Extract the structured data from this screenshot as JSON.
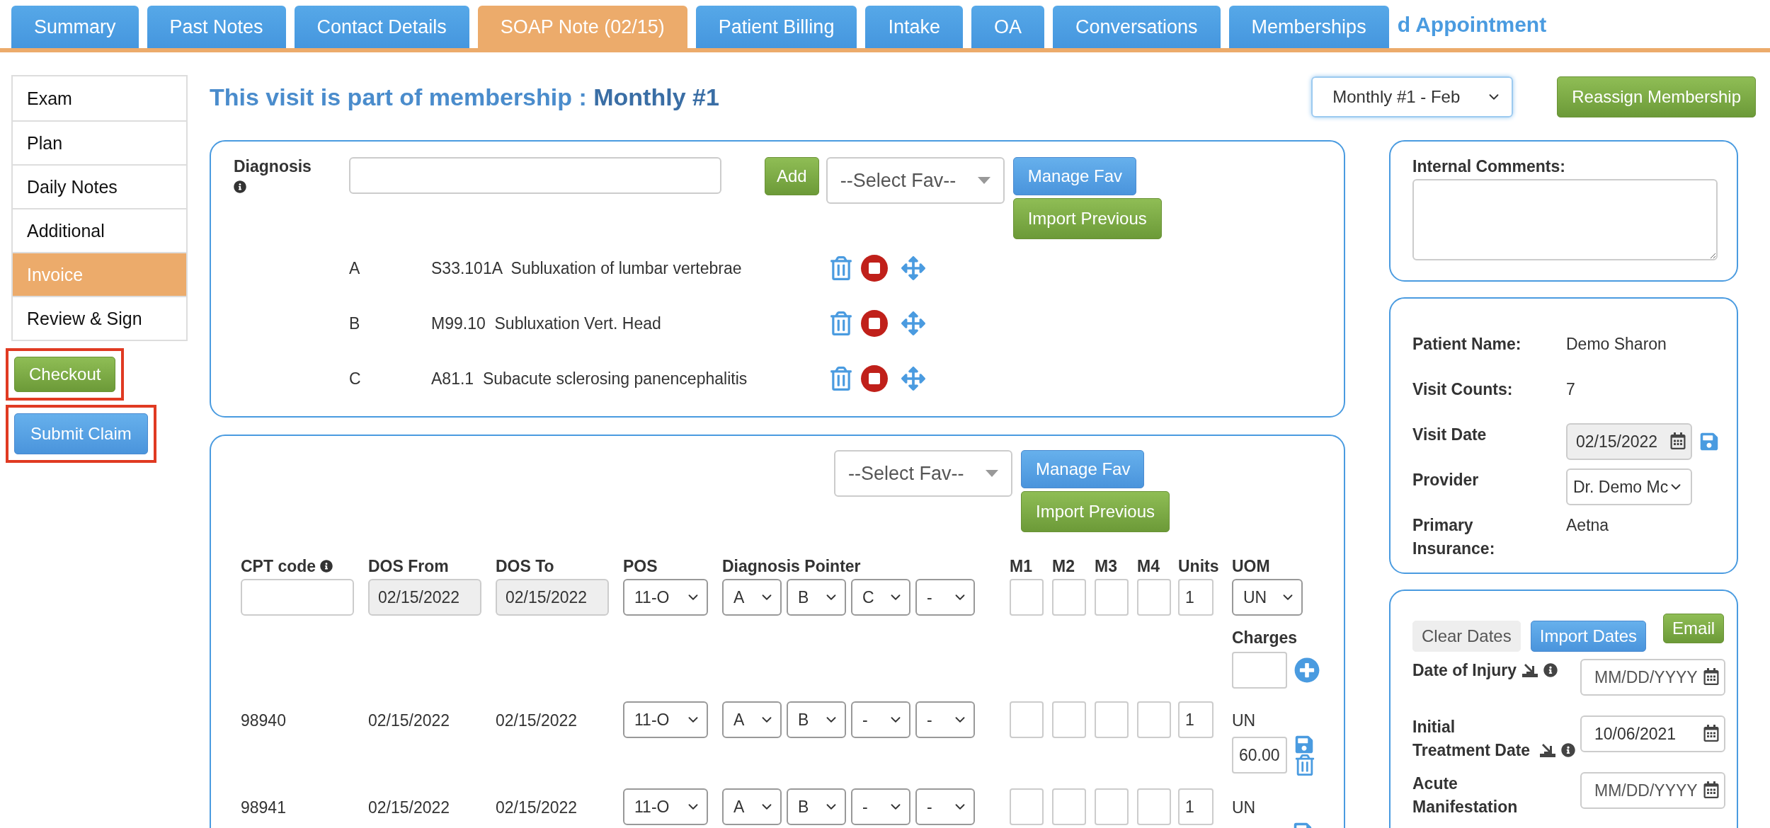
{
  "tabs": [
    {
      "label": "Summary",
      "selected": false
    },
    {
      "label": "Past Notes",
      "selected": false
    },
    {
      "label": "Contact Details",
      "selected": false
    },
    {
      "label": "SOAP Note (02/15)",
      "selected": true
    },
    {
      "label": "Patient Billing",
      "selected": false
    },
    {
      "label": "Intake",
      "selected": false
    },
    {
      "label": "OA",
      "selected": false
    },
    {
      "label": "Conversations",
      "selected": false
    },
    {
      "label": "Memberships",
      "selected": false
    }
  ],
  "header_fragment": "d Appointment",
  "sidebar": {
    "items": [
      {
        "label": "Exam",
        "selected": false
      },
      {
        "label": "Plan",
        "selected": false
      },
      {
        "label": "Daily Notes",
        "selected": false
      },
      {
        "label": "Additional",
        "selected": false
      },
      {
        "label": "Invoice",
        "selected": true
      },
      {
        "label": "Review & Sign",
        "selected": false
      }
    ],
    "actions": [
      {
        "kind": "checkout",
        "label": "Checkout",
        "highlighted": true
      },
      {
        "kind": "submit",
        "label": "Submit Claim",
        "highlighted": true
      }
    ]
  },
  "membership": {
    "title": "This visit is part of membership : **Monthly #1**",
    "dropdown": "Monthly #1 - Feb",
    "button": "Reassign Membership"
  },
  "diagnosis": {
    "label": "Diagnosis",
    "add": "Add",
    "select_fav": "--Select Fav--",
    "manage_fav": "Manage Fav",
    "import_previous": "Import Previous",
    "rows": [
      {
        "letter": "A",
        "description": "S33.101A  Subluxation of lumbar vertebrae"
      },
      {
        "letter": "B",
        "description": "M99.10  Subluxation Vert. Head"
      },
      {
        "letter": "C",
        "description": "A81.1  Subacute sclerosing panencephalitis"
      }
    ]
  },
  "procedures": {
    "select_fav": "--Select Fav--",
    "manage_fav": "Manage Fav",
    "import_previous": "Import Previous",
    "columns": [
      {
        "label": "CPT code",
        "info": true
      },
      {
        "label": "DOS From",
        "info": false
      },
      {
        "label": "DOS To",
        "info": false
      },
      {
        "label": "POS",
        "info": false
      },
      {
        "label": "Diagnosis Pointer",
        "info": false
      },
      {
        "label": "M1",
        "info": false
      },
      {
        "label": "M2",
        "info": false
      },
      {
        "label": "M3",
        "info": false
      },
      {
        "label": "M4",
        "info": false
      },
      {
        "label": "Units",
        "info": false
      },
      {
        "label": "UOM",
        "info": false
      }
    ],
    "entry": {
      "dos_from": "02/15/2022",
      "dos_to": "02/15/2022",
      "pos": "11-O",
      "pointers": [
        "A",
        "B",
        "C",
        "-"
      ],
      "units": "1",
      "uom": "UN",
      "charges_label": "Charges"
    },
    "rows": [
      {
        "cpt": "98940",
        "dos_from": "02/15/2022",
        "dos_to": "02/15/2022",
        "pos": "11-O",
        "pointers": [
          "A",
          "B",
          "-",
          "-"
        ],
        "units": "1",
        "uom": "UN",
        "charge": "60.00"
      },
      {
        "cpt": "98941",
        "dos_from": "02/15/2022",
        "dos_to": "02/15/2022",
        "pos": "11-O",
        "pointers": [
          "A",
          "B",
          "-",
          "-"
        ],
        "units": "1",
        "uom": "UN"
      }
    ]
  },
  "internal_comments": {
    "label": "Internal Comments:"
  },
  "patient": {
    "fields": [
      {
        "kind": "text",
        "label": "Patient Name:",
        "value": "Demo Sharon"
      },
      {
        "kind": "text",
        "label": "Visit Counts:",
        "value": "7"
      },
      {
        "kind": "date",
        "label": "Visit Date",
        "value": "02/15/2022"
      },
      {
        "kind": "select",
        "label": "Provider",
        "value": "Dr. Demo Mc"
      },
      {
        "kind": "text",
        "label": "Primary Insurance:",
        "value": "Aetna"
      }
    ]
  },
  "dates": {
    "buttons": [
      {
        "kind": "clear",
        "label": "Clear Dates"
      },
      {
        "kind": "import",
        "label": "Import Dates"
      },
      {
        "kind": "email",
        "label": "Email"
      }
    ],
    "fields": [
      {
        "label": "Date of Injury",
        "importable": true,
        "placeholder": "MM/DD/YYYY"
      },
      {
        "label": "Initial Treatment Date",
        "importable": true,
        "value": "10/06/2021"
      },
      {
        "label": "Acute Manifestation",
        "importable": false,
        "placeholder": "MM/DD/YYYY"
      }
    ]
  }
}
